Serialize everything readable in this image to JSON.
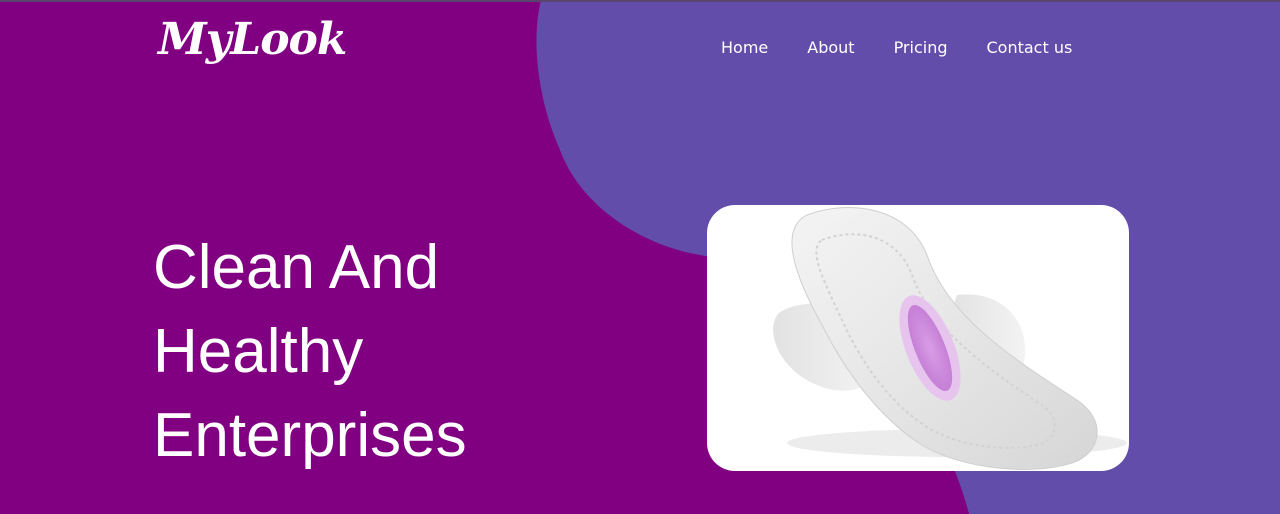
{
  "brand": {
    "logo_text": "MyLook"
  },
  "nav": {
    "items": [
      {
        "label": "Home"
      },
      {
        "label": "About"
      },
      {
        "label": "Pricing"
      },
      {
        "label": "Contact us"
      }
    ]
  },
  "hero": {
    "title_lines": [
      "Clean And",
      "Healthy",
      "Enterprises"
    ],
    "image_subject": "sanitary-pad-product-image"
  },
  "colors": {
    "background": "#810081",
    "blob": "#624daa",
    "text": "#ffffff",
    "pad_accent": "#cf86dc"
  }
}
